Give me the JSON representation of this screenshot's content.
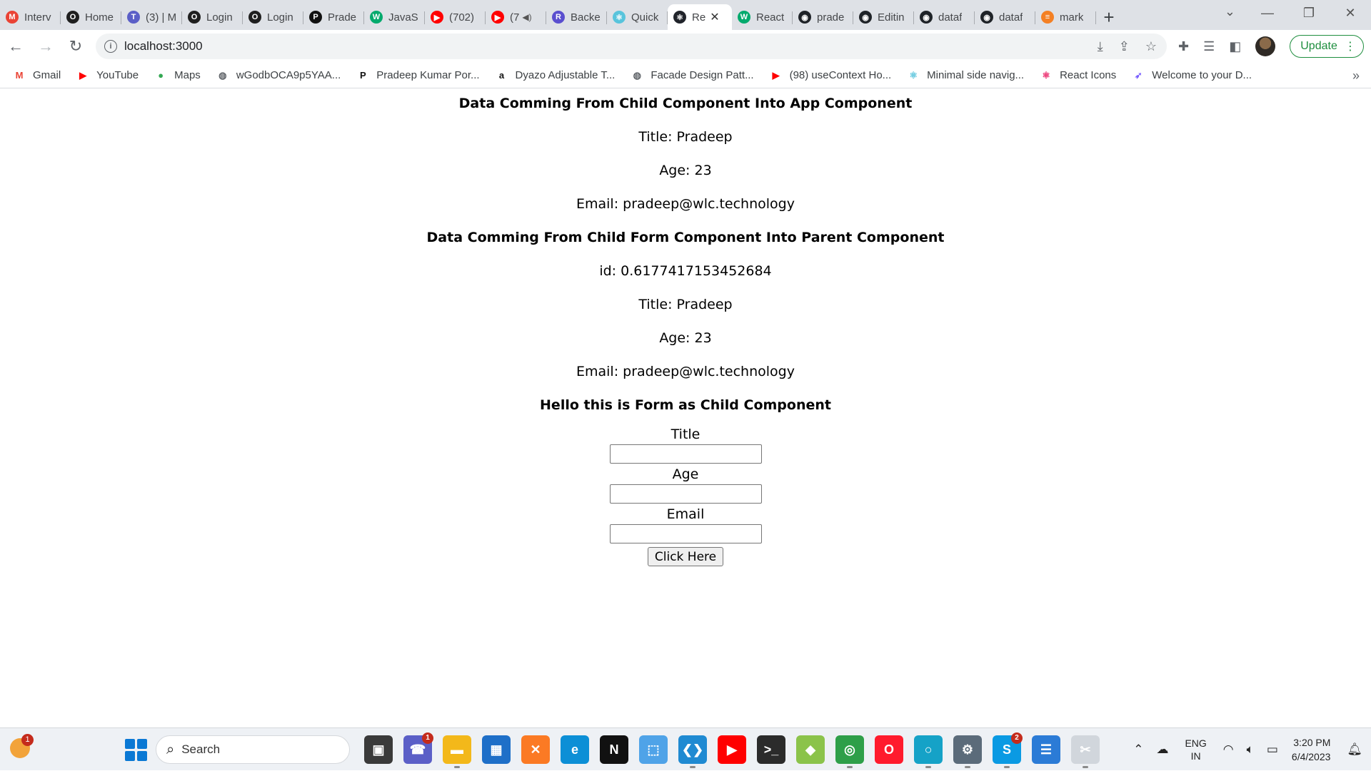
{
  "browser": {
    "tabs": [
      {
        "label": "Interv",
        "icon": "gmail-icon",
        "color": "#ea4335",
        "glyph": "M",
        "active": false
      },
      {
        "label": "Home",
        "icon": "opera-ring-icon",
        "color": "#1f1f1f",
        "glyph": "O",
        "active": false
      },
      {
        "label": "(3) | M",
        "icon": "teams-icon",
        "color": "#5b5fc7",
        "glyph": "T",
        "active": false
      },
      {
        "label": "Login",
        "icon": "opera-ring-icon",
        "color": "#1f1f1f",
        "glyph": "O",
        "active": false
      },
      {
        "label": "Login",
        "icon": "opera-ring-icon",
        "color": "#1f1f1f",
        "glyph": "O",
        "active": false
      },
      {
        "label": "Prade",
        "icon": "p-logo-icon",
        "color": "#111111",
        "glyph": "P",
        "active": false
      },
      {
        "label": "JavaS",
        "icon": "w3schools-icon",
        "color": "#04aa6d",
        "glyph": "W",
        "active": false
      },
      {
        "label": "(702)",
        "icon": "youtube-icon",
        "color": "#ff0000",
        "glyph": "▶",
        "active": false
      },
      {
        "label": "(7",
        "icon": "youtube-icon",
        "color": "#ff0000",
        "glyph": "▶",
        "active": false,
        "muted": true
      },
      {
        "label": "Backe",
        "icon": "r-logo-icon",
        "color": "#5a4fcf",
        "glyph": "R",
        "active": false
      },
      {
        "label": "Quick",
        "icon": "react-icon",
        "color": "#58c4dc",
        "glyph": "⚛",
        "active": false
      },
      {
        "label": "Re",
        "icon": "react-icon",
        "color": "#20232a",
        "glyph": "⚛",
        "active": true
      },
      {
        "label": "React",
        "icon": "w3schools-icon",
        "color": "#04aa6d",
        "glyph": "W",
        "active": false
      },
      {
        "label": "prade",
        "icon": "github-icon",
        "color": "#1f2328",
        "glyph": "◉",
        "active": false
      },
      {
        "label": "Editin",
        "icon": "github-icon",
        "color": "#1f2328",
        "glyph": "◉",
        "active": false
      },
      {
        "label": "dataf",
        "icon": "github-icon",
        "color": "#1f2328",
        "glyph": "◉",
        "active": false
      },
      {
        "label": "dataf",
        "icon": "github-icon",
        "color": "#1f2328",
        "glyph": "◉",
        "active": false
      },
      {
        "label": "mark",
        "icon": "stackoverflow-icon",
        "color": "#f48024",
        "glyph": "≡",
        "active": false
      }
    ],
    "url": "localhost:3000",
    "update_label": "Update",
    "bookmarks": [
      {
        "label": "Gmail",
        "icon": "gmail-icon",
        "color": "#ea4335",
        "glyph": "M"
      },
      {
        "label": "YouTube",
        "icon": "youtube-icon",
        "color": "#ff0000",
        "glyph": "▶"
      },
      {
        "label": "Maps",
        "icon": "maps-pin-icon",
        "color": "#34a853",
        "glyph": "●"
      },
      {
        "label": "wGodbOCA9p5YAA...",
        "icon": "globe-icon",
        "color": "#5f6368",
        "glyph": "◍"
      },
      {
        "label": "Pradeep Kumar Por...",
        "icon": "p-logo-icon",
        "color": "#111111",
        "glyph": "P"
      },
      {
        "label": "Dyazo Adjustable T...",
        "icon": "amazon-icon",
        "color": "#111111",
        "glyph": "a"
      },
      {
        "label": "Facade Design Patt...",
        "icon": "globe-icon",
        "color": "#5f6368",
        "glyph": "◍"
      },
      {
        "label": "(98) useContext Ho...",
        "icon": "youtube-icon",
        "color": "#ff0000",
        "glyph": "▶"
      },
      {
        "label": "Minimal side navig...",
        "icon": "react-icon",
        "color": "#58c4dc",
        "glyph": "⚛"
      },
      {
        "label": "React Icons",
        "icon": "react-icon",
        "color": "#e91e63",
        "glyph": "⚛"
      },
      {
        "label": "Welcome to your D...",
        "icon": "rocket-icon",
        "color": "#7b61ff",
        "glyph": "➶"
      }
    ]
  },
  "page": {
    "app_heading": "Data Comming From Child Component Into App Component",
    "app_title": "Title: Pradeep",
    "app_age": "Age: 23",
    "app_email": "Email: pradeep@wlc.technology",
    "parent_heading": "Data Comming From Child Form Component Into Parent Component",
    "parent_id": "id: 0.6177417153452684",
    "parent_title": "Title: Pradeep",
    "parent_age": "Age: 23",
    "parent_email": "Email: pradeep@wlc.technology",
    "form_heading": "Hello this is Form as Child Component",
    "form": {
      "title_label": "Title",
      "title_value": "",
      "age_label": "Age",
      "age_value": "",
      "email_label": "Email",
      "email_value": "",
      "submit_label": "Click Here"
    }
  },
  "taskbar": {
    "search_placeholder": "Search",
    "weather_badge": "1",
    "teams_badge": "1",
    "skype_badge": "2",
    "lang_line1": "ENG",
    "lang_line2": "IN",
    "time": "3:20 PM",
    "date": "6/4/2023",
    "apps": [
      {
        "name": "task-view-icon",
        "color": "#3a3a3a",
        "glyph": "▣"
      },
      {
        "name": "teams-chat-icon",
        "color": "#5b5fc7",
        "glyph": "☎"
      },
      {
        "name": "file-explorer-icon",
        "color": "#f3b81a",
        "glyph": "▬"
      },
      {
        "name": "microsoft-store-icon",
        "color": "#1e6fc8",
        "glyph": "▦"
      },
      {
        "name": "xampp-icon",
        "color": "#fb7a24",
        "glyph": "✕"
      },
      {
        "name": "edge-icon",
        "color": "#0c8fd6",
        "glyph": "e"
      },
      {
        "name": "netflix-icon",
        "color": "#111111",
        "glyph": "N"
      },
      {
        "name": "app-installer-icon",
        "color": "#4fa3e8",
        "glyph": "⬚"
      },
      {
        "name": "vscode-icon",
        "color": "#1f8ad2",
        "glyph": "❮❯"
      },
      {
        "name": "youtube-app-icon",
        "color": "#ff0000",
        "glyph": "▶"
      },
      {
        "name": "terminal-icon",
        "color": "#2b2b2b",
        "glyph": ">_"
      },
      {
        "name": "git-tool-icon",
        "color": "#8bc34a",
        "glyph": "◆"
      },
      {
        "name": "chrome-icon",
        "color": "#2e9f49",
        "glyph": "◎"
      },
      {
        "name": "opera-icon",
        "color": "#ff1b2d",
        "glyph": "O"
      },
      {
        "name": "alexa-icon",
        "color": "#15a2c7",
        "glyph": "○"
      },
      {
        "name": "settings-icon",
        "color": "#5b6b7a",
        "glyph": "⚙"
      },
      {
        "name": "skype-icon",
        "color": "#0a9ae3",
        "glyph": "S"
      },
      {
        "name": "notepad-icon",
        "color": "#2b7bd6",
        "glyph": "☰"
      },
      {
        "name": "snipping-tool-icon",
        "color": "#d1d6dc",
        "glyph": "✂"
      }
    ]
  }
}
